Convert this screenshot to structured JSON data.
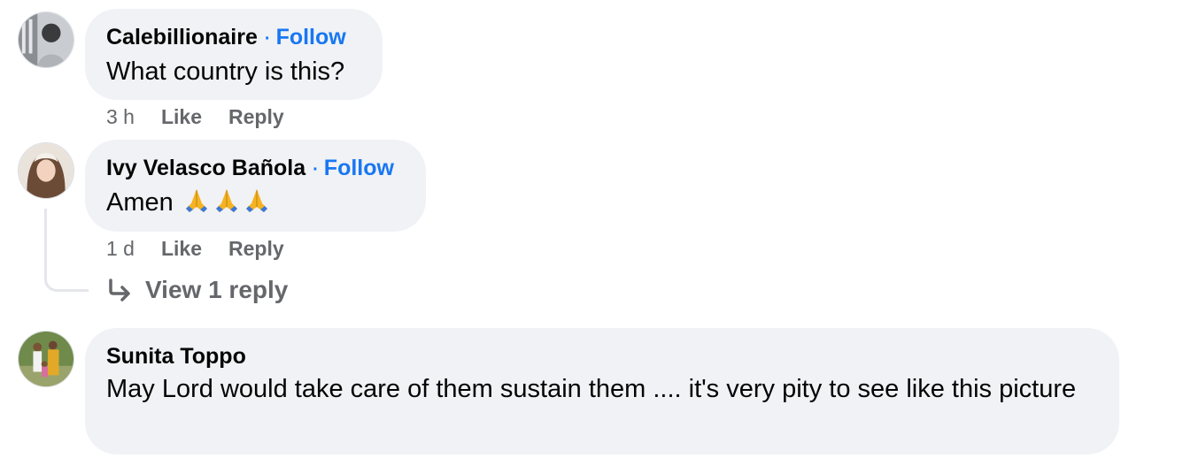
{
  "comments": [
    {
      "author": "Calebillionaire",
      "separator": "·",
      "follow_label": "Follow",
      "text": "What country is this?",
      "time": "3 h",
      "like_label": "Like",
      "reply_label": "Reply",
      "avatar_icon": "user-avatar-photo"
    },
    {
      "author": "Ivy Velasco Bañola",
      "separator": "·",
      "follow_label": "Follow",
      "text": "Amen",
      "emoji": [
        "folded-hands-icon",
        "folded-hands-icon",
        "folded-hands-icon"
      ],
      "time": "1 d",
      "like_label": "Like",
      "reply_label": "Reply",
      "view_replies_label": "View 1 reply",
      "avatar_icon": "user-avatar-photo"
    },
    {
      "author": "Sunita Toppo",
      "text": "May Lord would take care of them sustain them .... it's very pity to see like this picture",
      "avatar_icon": "user-avatar-photo"
    }
  ],
  "colors": {
    "bubble_bg": "#f0f2f5",
    "follow": "#1877f2",
    "meta": "#65676b",
    "text": "#050505"
  }
}
